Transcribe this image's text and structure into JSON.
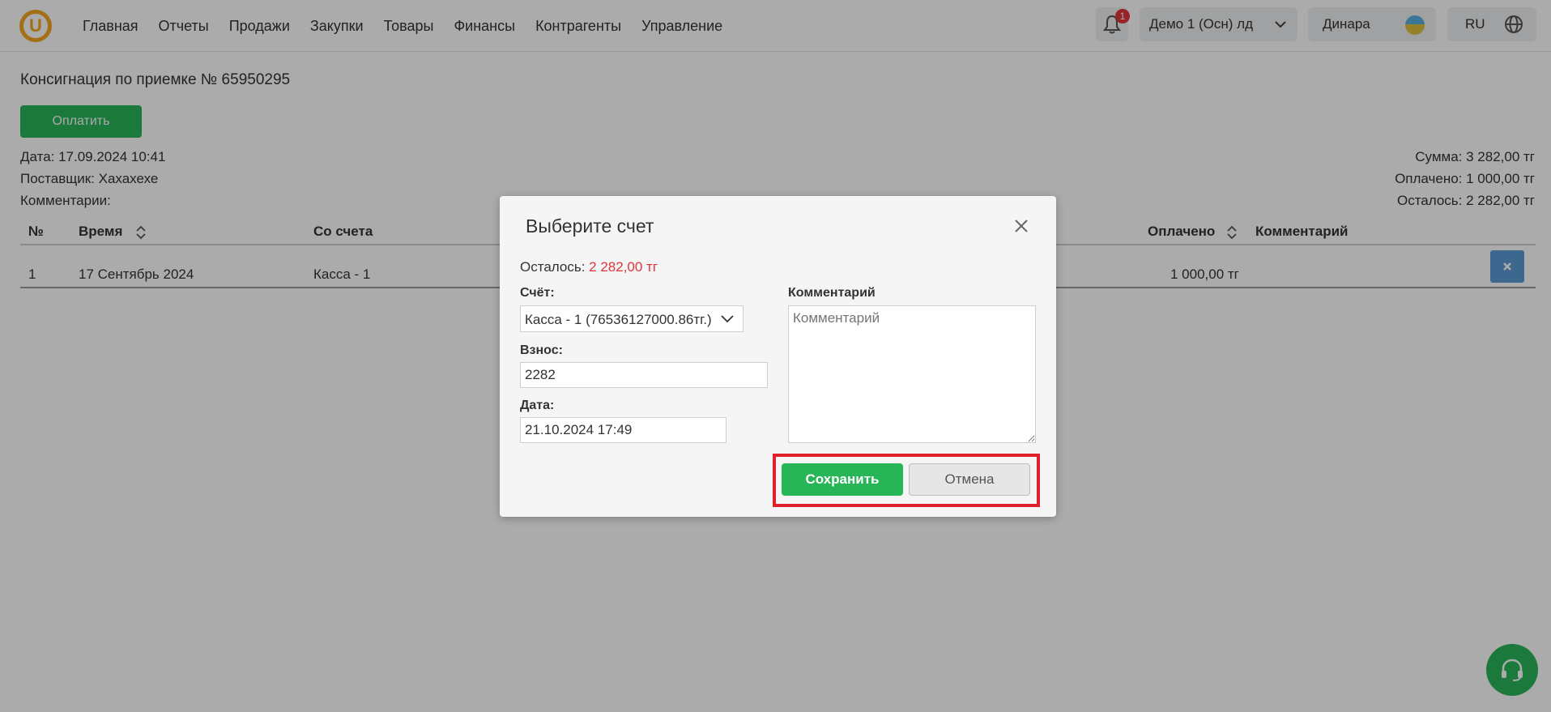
{
  "nav": {
    "logo_letter": "U",
    "items": [
      "Главная",
      "Отчеты",
      "Продажи",
      "Закупки",
      "Товары",
      "Финансы",
      "Контрагенты",
      "Управление"
    ],
    "notifications_count": "1",
    "store": "Демо 1 (Осн) лд",
    "user": "Динара",
    "lang": "RU"
  },
  "page": {
    "title": "Консигнация по приемке № 65950295",
    "pay_button": "Оплатить",
    "date": "Дата: 17.09.2024 10:41",
    "supplier": "Поставщик: Хахахехе",
    "comments": "Комментарии:",
    "sum": "Сумма: 3 282,00 тг",
    "paid": "Оплачено: 1 000,00 тг",
    "remaining": "Осталось: 2 282,00 тг"
  },
  "table": {
    "headers": {
      "num": "№",
      "time": "Время",
      "from_account": "Со счета",
      "paid": "Оплачено",
      "comment": "Комментарий"
    },
    "rows": [
      {
        "num": "1",
        "time": "17 Сентябрь 2024",
        "from_account": "Касса - 1",
        "paid": "1 000,00 тг",
        "comment": ""
      }
    ]
  },
  "modal": {
    "title": "Выберите счет",
    "remaining_label": "Осталось:",
    "remaining_value": "2 282,00 тг",
    "account_label": "Счёт:",
    "account_value": "Касса - 1 (76536127000.86тг.)",
    "deposit_label": "Взнос:",
    "deposit_value": "2282",
    "date_label": "Дата:",
    "date_value": "21.10.2024 17:49",
    "comment_label": "Комментарий",
    "comment_placeholder": "Комментарий",
    "save_button": "Сохранить",
    "cancel_button": "Отмена"
  },
  "colors": {
    "accent_green": "#27b558",
    "danger_red": "#e2353b",
    "highlight_red": "#e0202a",
    "delete_blue": "#5b9ad6",
    "logo_orange": "#f5a623"
  }
}
